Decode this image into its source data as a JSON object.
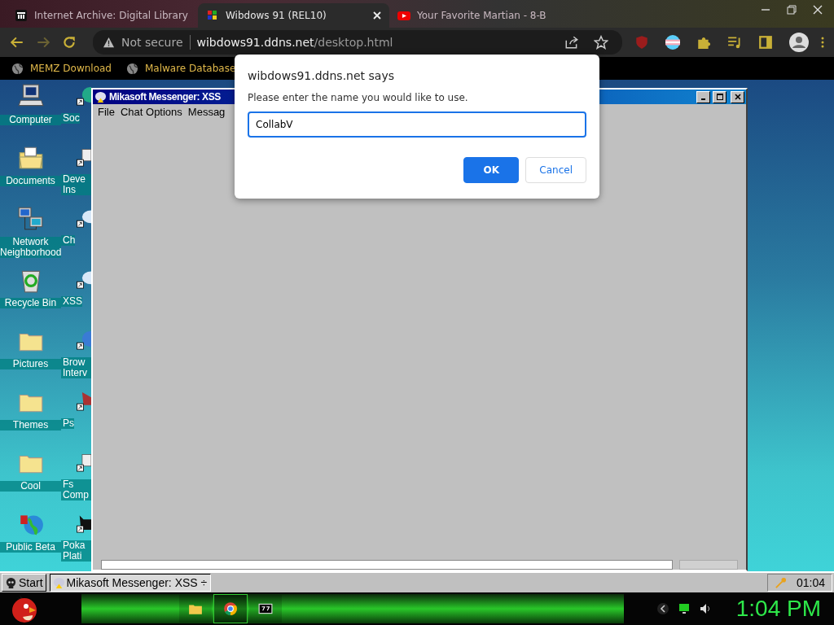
{
  "browser": {
    "tabs": [
      {
        "title": "Internet Archive: Digital Library",
        "selected": false,
        "kind": "archive"
      },
      {
        "title": "Wibdows 91 (REL10)",
        "selected": true,
        "kind": "wibdows"
      },
      {
        "title": "Your Favorite Martian - 8-B",
        "selected": false,
        "kind": "video"
      }
    ],
    "security": "Not secure",
    "url_host": "wibdows91.ddns.net",
    "url_path": "/desktop.html",
    "bookmarks": [
      "MEMZ Download",
      "Malware Database"
    ]
  },
  "desktop": {
    "icons": [
      {
        "label": "Computer",
        "kind": "computer"
      },
      {
        "label": "Documents",
        "kind": "documents"
      },
      {
        "label": "Network Neighborhood",
        "kind": "network"
      },
      {
        "label": "Recycle Bin",
        "kind": "recycle"
      },
      {
        "label": "Pictures",
        "kind": "folder"
      },
      {
        "label": "Themes",
        "kind": "folder"
      },
      {
        "label": "Cool",
        "kind": "folder"
      },
      {
        "label": "Public Beta",
        "kind": "globe"
      }
    ],
    "shortcuts": [
      {
        "label": "Soc",
        "kind": "globe"
      },
      {
        "label": "Deve Ins",
        "kind": "document"
      },
      {
        "label": "Ch",
        "kind": "bubble"
      },
      {
        "label": "XSS",
        "kind": "bubble"
      },
      {
        "label": "Brow Interv",
        "kind": "browser"
      },
      {
        "label": "Ps",
        "kind": "paint"
      },
      {
        "label": "Fs Comp",
        "kind": "computer"
      },
      {
        "label": "Poka Plati",
        "kind": "cat"
      }
    ]
  },
  "window": {
    "title": "Mikasoft Messenger: XSS",
    "menu": [
      "File",
      "Chat Options",
      "Messag"
    ]
  },
  "dialog": {
    "title": "wibdows91.ddns.net says",
    "message": "Please enter the name you would like to use.",
    "value": "CollabV",
    "buttons": [
      {
        "label": "OK",
        "primary": true
      },
      {
        "label": "Cancel",
        "primary": false
      }
    ]
  },
  "taskbar": {
    "start": "Start",
    "tasks": [
      {
        "label": "Mikasoft Messenger: XSS ÷",
        "selected": true
      }
    ],
    "clock": "01:04"
  },
  "host_taskbar": {
    "apps": [
      {
        "kind": "folder",
        "selected": false
      },
      {
        "kind": "chrome",
        "selected": true
      },
      {
        "kind": "zip",
        "selected": false
      }
    ],
    "clock": "1:04 PM"
  }
}
